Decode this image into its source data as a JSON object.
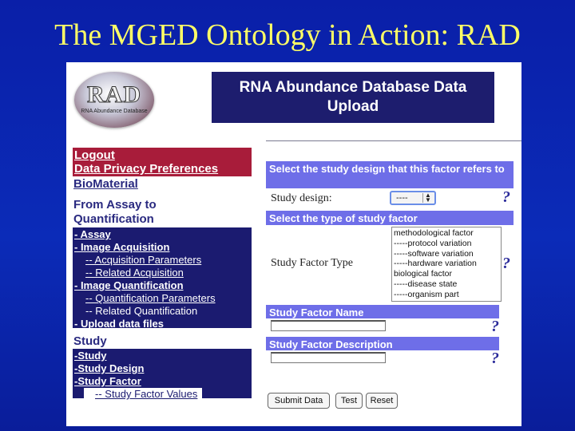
{
  "slide": {
    "title": "The MGED Ontology in Action: RAD"
  },
  "logo": {
    "big_text": "RAD",
    "small_text": "RNA Abundance Database"
  },
  "header": {
    "line1": "RNA Abundance Database Data",
    "line2": "Upload"
  },
  "nav": {
    "top_links": [
      "Logout",
      "Data Privacy Preferences"
    ],
    "biomaterial": "BioMaterial",
    "assay_heading": "From Assay to Quantification",
    "assay_items": [
      "- Assay",
      "- Image Acquisition",
      "-- Acquisition Parameters",
      "-- Related Acquisition",
      "- Image Quantification",
      "-- Quantification Parameters",
      "-- Related Quantification",
      "- Upload data files"
    ],
    "study_heading": "Study",
    "study_items": [
      "-Study",
      "-Study Design",
      "-Study Factor",
      "-- Study Factor Values"
    ]
  },
  "form": {
    "design_bar": "Select the study design that this factor refers to",
    "study_design_label": "Study design:",
    "study_design_value": "----",
    "factor_type_bar": "Select the type of study factor",
    "factor_type_label": "Study Factor Type",
    "factor_type_options": [
      "methodological factor",
      "-----protocol variation",
      "-----software variation",
      "-----hardware variation",
      "biological factor",
      "-----disease state",
      "-----organism part"
    ],
    "factor_name_bar": "Study Factor Name",
    "factor_desc_bar": "Study Factor Description",
    "help_mark": "?"
  },
  "buttons": {
    "submit": "Submit Data",
    "test": "Test",
    "reset": "Reset"
  },
  "colors": {
    "background": "#0b2bb8",
    "title": "#ffff66",
    "maroon": "#a81c3a",
    "navy": "#1b1b70",
    "bar": "#6e6ee8"
  }
}
